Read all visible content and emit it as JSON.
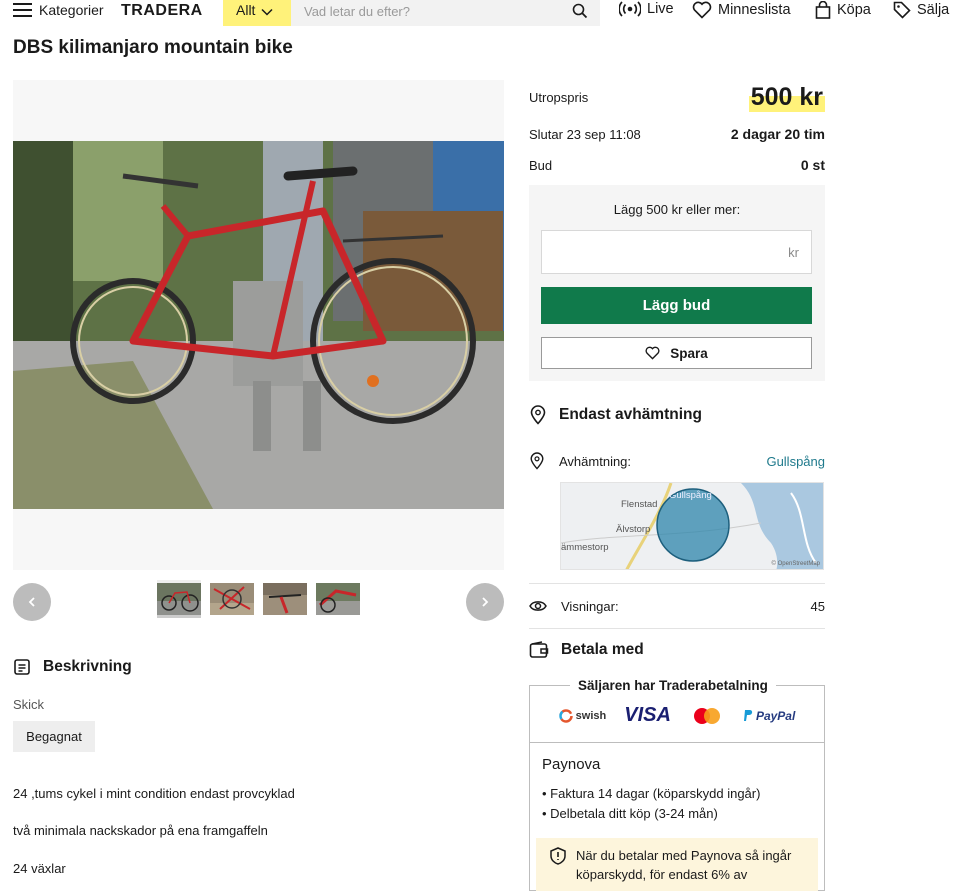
{
  "header": {
    "menu_label": "Kategorier",
    "logo": "TRADERA",
    "category_selected": "Allt",
    "search_placeholder": "Vad letar du efter?",
    "nav": {
      "live": "Live",
      "wishlist": "Minneslista",
      "buy": "Köpa",
      "sell": "Sälja"
    }
  },
  "listing": {
    "title": "DBS kilimanjaro mountain bike"
  },
  "gallery": {
    "thumbnail_count": 4
  },
  "auction": {
    "start_price_label": "Utropspris",
    "start_price": "500 kr",
    "ends_label": "Slutar 23 sep 11:08",
    "time_left": "2 dagar 20 tim",
    "bids_label": "Bud",
    "bids_value": "0 st",
    "bid_hint": "Lägg 500 kr eller mer:",
    "bid_currency": "kr",
    "bid_button": "Lägg bud",
    "save_button": "Spara"
  },
  "pickup": {
    "heading": "Endast avhämtning",
    "label": "Avhämtning:",
    "location": "Gullspång",
    "map_places": [
      "Flenstad",
      "Gullspång",
      "Älvstorp",
      "ämmestorp"
    ],
    "map_credit": "© OpenStreetMap"
  },
  "stats": {
    "views_label": "Visningar:",
    "views_value": "45"
  },
  "payment": {
    "heading": "Betala med",
    "box_title": "Säljaren har Traderabetalning",
    "logos": [
      "swish",
      "VISA",
      "Mastercard",
      "PayPal"
    ],
    "provider": "Paynova",
    "options": [
      "Faktura 14 dagar (köparskydd ingår)",
      "Delbetala ditt köp (3-24 mån)"
    ],
    "note": "När du betalar med Paynova så ingår köparskydd, för endast 6% av"
  },
  "description": {
    "heading": "Beskrivning",
    "condition_label": "Skick",
    "condition_value": "Begagnat",
    "lines": [
      "24 ,tums cykel i mint condition endast provcyklad",
      "två minimala nackskador på ena framgaffeln",
      "24 växlar"
    ]
  },
  "colors": {
    "accent_yellow": "#fff27a",
    "bid_green": "#107a4b",
    "link_teal": "#1f7a8c",
    "map_circle": "#2e86ab"
  }
}
